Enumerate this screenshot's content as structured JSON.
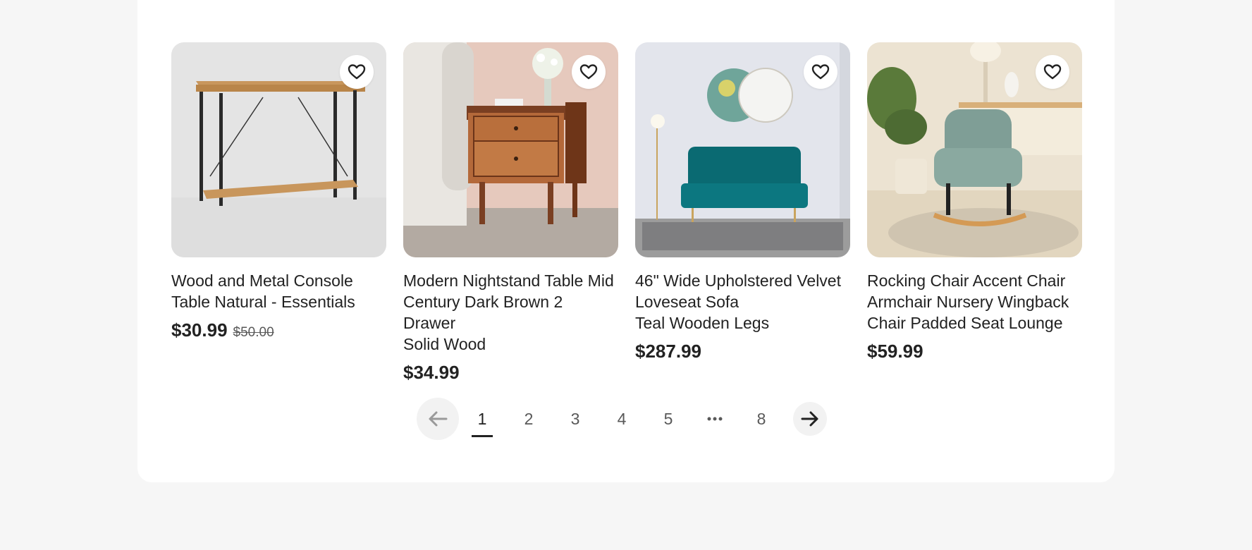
{
  "products": [
    {
      "title_lines": [
        "Wood and Metal Console",
        "Table Natural - Essentials"
      ],
      "price": "$30.99",
      "original_price": "$50.00",
      "image_icon": "console-table-image",
      "favorite_icon": "heart-outline-icon"
    },
    {
      "title_lines": [
        "Modern Nightstand Table Mid",
        "Century Dark Brown 2 Drawer",
        "Solid Wood"
      ],
      "price": "$34.99",
      "image_icon": "nightstand-image",
      "favorite_icon": "heart-outline-icon"
    },
    {
      "title_lines": [
        "46\" Wide Upholstered Velvet",
        "Loveseat Sofa",
        "Teal Wooden Legs"
      ],
      "price": "$287.99",
      "image_icon": "loveseat-image",
      "favorite_icon": "heart-outline-icon"
    },
    {
      "title_lines": [
        "Rocking Chair Accent Chair",
        "Armchair Nursery Wingback",
        "Chair Padded Seat Lounge"
      ],
      "price": "$59.99",
      "image_icon": "rocking-chair-image",
      "favorite_icon": "heart-outline-icon"
    }
  ],
  "pagination": {
    "prev_icon": "arrow-left-icon",
    "next_icon": "arrow-right-icon",
    "pages": [
      "1",
      "2",
      "3",
      "4",
      "5"
    ],
    "ellipsis_icon": "ellipsis-icon",
    "last_page": "8",
    "current_page": "1"
  },
  "colors": {
    "page_background": "#f6f6f6",
    "panel_background": "#ffffff",
    "text": "#222222",
    "muted_text": "#595959",
    "button_background": "#f2f2f2"
  }
}
